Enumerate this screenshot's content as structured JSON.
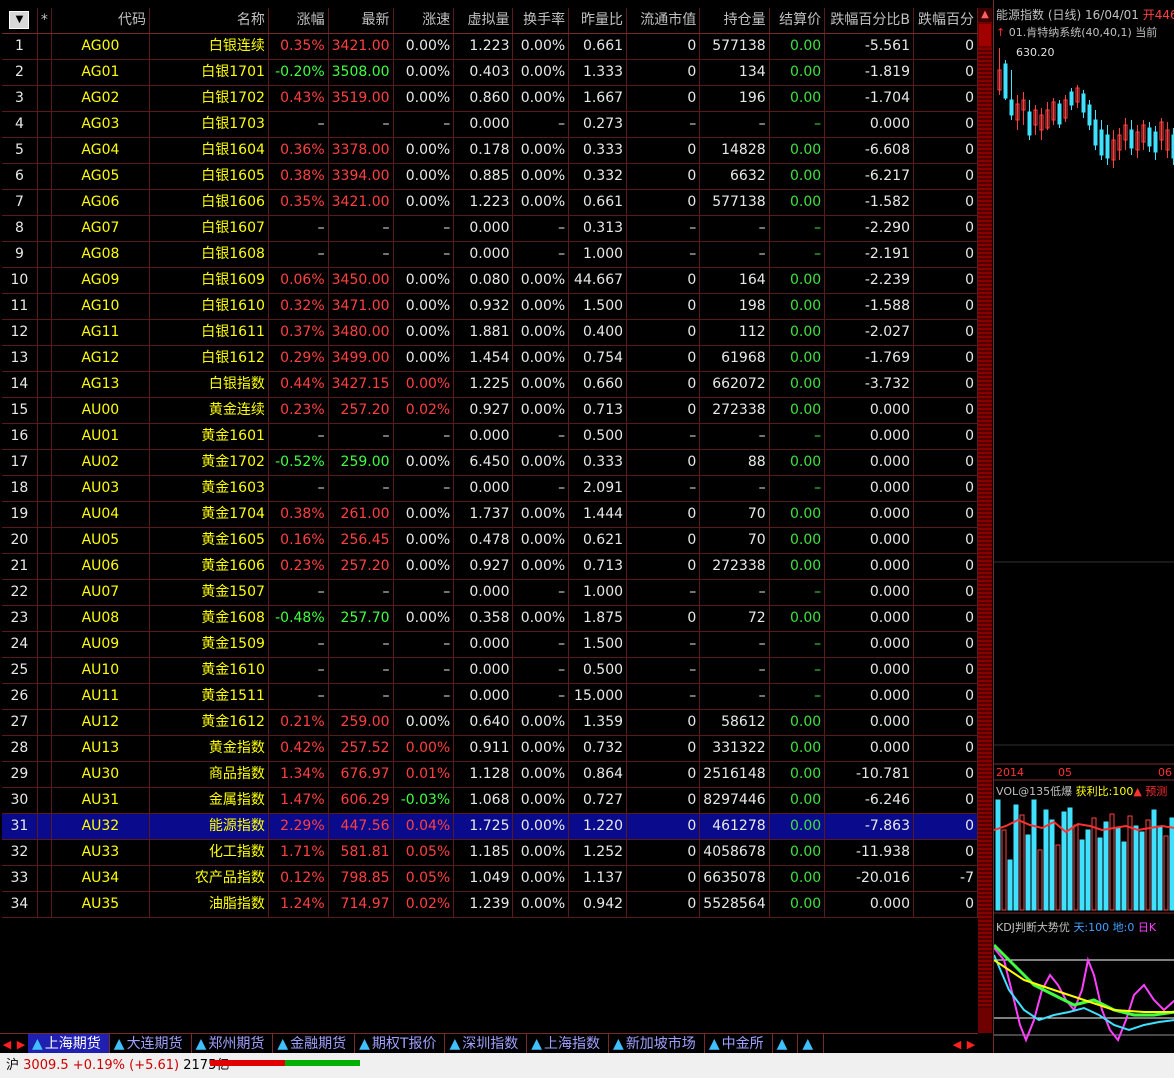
{
  "table": {
    "headers": [
      "*",
      "代码",
      "名称",
      "涨幅",
      "最新",
      "涨速",
      "虚拟量",
      "换手率",
      "昨量比",
      "流通市值",
      "持仓量",
      "结算价",
      "跌幅百分比B",
      "跌幅百分"
    ],
    "sort_icon": "sort-down-icon",
    "selected_row": 31,
    "rows": [
      {
        "idx": "1",
        "code": "AG00",
        "name": "白银连续",
        "chg": "0.35%",
        "last": "3421.00",
        "spd": "0.00%",
        "vol": "1.223",
        "turn": "0.00%",
        "vr": "0.661",
        "mv": "0",
        "oi": "577138",
        "settle": "0.00",
        "pb": "-5.561",
        "pc": "0",
        "dir": "up"
      },
      {
        "idx": "2",
        "code": "AG01",
        "name": "白银1701",
        "chg": "-0.20%",
        "last": "3508.00",
        "spd": "0.00%",
        "vol": "0.403",
        "turn": "0.00%",
        "vr": "1.333",
        "mv": "0",
        "oi": "134",
        "settle": "0.00",
        "pb": "-1.819",
        "pc": "0",
        "dir": "dn"
      },
      {
        "idx": "3",
        "code": "AG02",
        "name": "白银1702",
        "chg": "0.43%",
        "last": "3519.00",
        "spd": "0.00%",
        "vol": "0.860",
        "turn": "0.00%",
        "vr": "1.667",
        "mv": "0",
        "oi": "196",
        "settle": "0.00",
        "pb": "-1.704",
        "pc": "0",
        "dir": "up"
      },
      {
        "idx": "4",
        "code": "AG03",
        "name": "白银1703",
        "chg": "–",
        "last": "–",
        "spd": "–",
        "vol": "0.000",
        "turn": "–",
        "vr": "0.273",
        "mv": "–",
        "oi": "–",
        "settle": "–",
        "pb": "0.000",
        "pc": "0",
        "dir": "none"
      },
      {
        "idx": "5",
        "code": "AG04",
        "name": "白银1604",
        "chg": "0.36%",
        "last": "3378.00",
        "spd": "0.00%",
        "vol": "0.178",
        "turn": "0.00%",
        "vr": "0.333",
        "mv": "0",
        "oi": "14828",
        "settle": "0.00",
        "pb": "-6.608",
        "pc": "0",
        "dir": "up"
      },
      {
        "idx": "6",
        "code": "AG05",
        "name": "白银1605",
        "chg": "0.38%",
        "last": "3394.00",
        "spd": "0.00%",
        "vol": "0.885",
        "turn": "0.00%",
        "vr": "0.332",
        "mv": "0",
        "oi": "6632",
        "settle": "0.00",
        "pb": "-6.217",
        "pc": "0",
        "dir": "up"
      },
      {
        "idx": "7",
        "code": "AG06",
        "name": "白银1606",
        "chg": "0.35%",
        "last": "3421.00",
        "spd": "0.00%",
        "vol": "1.223",
        "turn": "0.00%",
        "vr": "0.661",
        "mv": "0",
        "oi": "577138",
        "settle": "0.00",
        "pb": "-1.582",
        "pc": "0",
        "dir": "up"
      },
      {
        "idx": "8",
        "code": "AG07",
        "name": "白银1607",
        "chg": "–",
        "last": "–",
        "spd": "–",
        "vol": "0.000",
        "turn": "–",
        "vr": "0.313",
        "mv": "–",
        "oi": "–",
        "settle": "–",
        "pb": "-2.290",
        "pc": "0",
        "dir": "none"
      },
      {
        "idx": "9",
        "code": "AG08",
        "name": "白银1608",
        "chg": "–",
        "last": "–",
        "spd": "–",
        "vol": "0.000",
        "turn": "–",
        "vr": "1.000",
        "mv": "–",
        "oi": "–",
        "settle": "–",
        "pb": "-2.191",
        "pc": "0",
        "dir": "none"
      },
      {
        "idx": "10",
        "code": "AG09",
        "name": "白银1609",
        "chg": "0.06%",
        "last": "3450.00",
        "spd": "0.00%",
        "vol": "0.080",
        "turn": "0.00%",
        "vr": "44.667",
        "mv": "0",
        "oi": "164",
        "settle": "0.00",
        "pb": "-2.239",
        "pc": "0",
        "dir": "up"
      },
      {
        "idx": "11",
        "code": "AG10",
        "name": "白银1610",
        "chg": "0.32%",
        "last": "3471.00",
        "spd": "0.00%",
        "vol": "0.932",
        "turn": "0.00%",
        "vr": "1.500",
        "mv": "0",
        "oi": "198",
        "settle": "0.00",
        "pb": "-1.588",
        "pc": "0",
        "dir": "up"
      },
      {
        "idx": "12",
        "code": "AG11",
        "name": "白银1611",
        "chg": "0.37%",
        "last": "3480.00",
        "spd": "0.00%",
        "vol": "1.881",
        "turn": "0.00%",
        "vr": "0.400",
        "mv": "0",
        "oi": "112",
        "settle": "0.00",
        "pb": "-2.027",
        "pc": "0",
        "dir": "up"
      },
      {
        "idx": "13",
        "code": "AG12",
        "name": "白银1612",
        "chg": "0.29%",
        "last": "3499.00",
        "spd": "0.00%",
        "vol": "1.454",
        "turn": "0.00%",
        "vr": "0.754",
        "mv": "0",
        "oi": "61968",
        "settle": "0.00",
        "pb": "-1.769",
        "pc": "0",
        "dir": "up"
      },
      {
        "idx": "14",
        "code": "AG13",
        "name": "白银指数",
        "chg": "0.44%",
        "last": "3427.15",
        "spd": "0.00%",
        "vol": "1.225",
        "turn": "0.00%",
        "vr": "0.660",
        "mv": "0",
        "oi": "662072",
        "settle": "0.00",
        "pb": "-3.732",
        "pc": "0",
        "dir": "up",
        "spdDir": "up"
      },
      {
        "idx": "15",
        "code": "AU00",
        "name": "黄金连续",
        "chg": "0.23%",
        "last": "257.20",
        "spd": "0.02%",
        "vol": "0.927",
        "turn": "0.00%",
        "vr": "0.713",
        "mv": "0",
        "oi": "272338",
        "settle": "0.00",
        "pb": "0.000",
        "pc": "0",
        "dir": "up",
        "spdDir": "up"
      },
      {
        "idx": "16",
        "code": "AU01",
        "name": "黄金1601",
        "chg": "–",
        "last": "–",
        "spd": "–",
        "vol": "0.000",
        "turn": "–",
        "vr": "0.500",
        "mv": "–",
        "oi": "–",
        "settle": "–",
        "pb": "0.000",
        "pc": "0",
        "dir": "none"
      },
      {
        "idx": "17",
        "code": "AU02",
        "name": "黄金1702",
        "chg": "-0.52%",
        "last": "259.00",
        "spd": "0.00%",
        "vol": "6.450",
        "turn": "0.00%",
        "vr": "0.333",
        "mv": "0",
        "oi": "88",
        "settle": "0.00",
        "pb": "0.000",
        "pc": "0",
        "dir": "dn"
      },
      {
        "idx": "18",
        "code": "AU03",
        "name": "黄金1603",
        "chg": "–",
        "last": "–",
        "spd": "–",
        "vol": "0.000",
        "turn": "–",
        "vr": "2.091",
        "mv": "–",
        "oi": "–",
        "settle": "–",
        "pb": "0.000",
        "pc": "0",
        "dir": "none"
      },
      {
        "idx": "19",
        "code": "AU04",
        "name": "黄金1704",
        "chg": "0.38%",
        "last": "261.00",
        "spd": "0.00%",
        "vol": "1.737",
        "turn": "0.00%",
        "vr": "1.444",
        "mv": "0",
        "oi": "70",
        "settle": "0.00",
        "pb": "0.000",
        "pc": "0",
        "dir": "up"
      },
      {
        "idx": "20",
        "code": "AU05",
        "name": "黄金1605",
        "chg": "0.16%",
        "last": "256.45",
        "spd": "0.00%",
        "vol": "0.478",
        "turn": "0.00%",
        "vr": "0.621",
        "mv": "0",
        "oi": "70",
        "settle": "0.00",
        "pb": "0.000",
        "pc": "0",
        "dir": "up"
      },
      {
        "idx": "21",
        "code": "AU06",
        "name": "黄金1606",
        "chg": "0.23%",
        "last": "257.20",
        "spd": "0.00%",
        "vol": "0.927",
        "turn": "0.00%",
        "vr": "0.713",
        "mv": "0",
        "oi": "272338",
        "settle": "0.00",
        "pb": "0.000",
        "pc": "0",
        "dir": "up"
      },
      {
        "idx": "22",
        "code": "AU07",
        "name": "黄金1507",
        "chg": "–",
        "last": "–",
        "spd": "–",
        "vol": "0.000",
        "turn": "–",
        "vr": "1.000",
        "mv": "–",
        "oi": "–",
        "settle": "–",
        "pb": "0.000",
        "pc": "0",
        "dir": "none"
      },
      {
        "idx": "23",
        "code": "AU08",
        "name": "黄金1608",
        "chg": "-0.48%",
        "last": "257.70",
        "spd": "0.00%",
        "vol": "0.358",
        "turn": "0.00%",
        "vr": "1.875",
        "mv": "0",
        "oi": "72",
        "settle": "0.00",
        "pb": "0.000",
        "pc": "0",
        "dir": "dn"
      },
      {
        "idx": "24",
        "code": "AU09",
        "name": "黄金1509",
        "chg": "–",
        "last": "–",
        "spd": "–",
        "vol": "0.000",
        "turn": "–",
        "vr": "1.500",
        "mv": "–",
        "oi": "–",
        "settle": "–",
        "pb": "0.000",
        "pc": "0",
        "dir": "none"
      },
      {
        "idx": "25",
        "code": "AU10",
        "name": "黄金1610",
        "chg": "–",
        "last": "–",
        "spd": "–",
        "vol": "0.000",
        "turn": "–",
        "vr": "0.500",
        "mv": "–",
        "oi": "–",
        "settle": "–",
        "pb": "0.000",
        "pc": "0",
        "dir": "none"
      },
      {
        "idx": "26",
        "code": "AU11",
        "name": "黄金1511",
        "chg": "–",
        "last": "–",
        "spd": "–",
        "vol": "0.000",
        "turn": "–",
        "vr": "15.000",
        "mv": "–",
        "oi": "–",
        "settle": "–",
        "pb": "0.000",
        "pc": "0",
        "dir": "none"
      },
      {
        "idx": "27",
        "code": "AU12",
        "name": "黄金1612",
        "chg": "0.21%",
        "last": "259.00",
        "spd": "0.00%",
        "vol": "0.640",
        "turn": "0.00%",
        "vr": "1.359",
        "mv": "0",
        "oi": "58612",
        "settle": "0.00",
        "pb": "0.000",
        "pc": "0",
        "dir": "up"
      },
      {
        "idx": "28",
        "code": "AU13",
        "name": "黄金指数",
        "chg": "0.42%",
        "last": "257.52",
        "spd": "0.00%",
        "vol": "0.911",
        "turn": "0.00%",
        "vr": "0.732",
        "mv": "0",
        "oi": "331322",
        "settle": "0.00",
        "pb": "0.000",
        "pc": "0",
        "dir": "up",
        "spdDir": "up"
      },
      {
        "idx": "29",
        "code": "AU30",
        "name": "商品指数",
        "chg": "1.34%",
        "last": "676.97",
        "spd": "0.01%",
        "vol": "1.128",
        "turn": "0.00%",
        "vr": "0.864",
        "mv": "0",
        "oi": "2516148",
        "settle": "0.00",
        "pb": "-10.781",
        "pc": "0",
        "dir": "up",
        "spdDir": "up"
      },
      {
        "idx": "30",
        "code": "AU31",
        "name": "金属指数",
        "chg": "1.47%",
        "last": "606.29",
        "spd": "-0.03%",
        "vol": "1.068",
        "turn": "0.00%",
        "vr": "0.727",
        "mv": "0",
        "oi": "8297446",
        "settle": "0.00",
        "pb": "-6.246",
        "pc": "0",
        "dir": "up",
        "spdDir": "dn"
      },
      {
        "idx": "31",
        "code": "AU32",
        "name": "能源指数",
        "chg": "2.29%",
        "last": "447.56",
        "spd": "0.04%",
        "vol": "1.725",
        "turn": "0.00%",
        "vr": "1.220",
        "mv": "0",
        "oi": "461278",
        "settle": "0.00",
        "pb": "-7.863",
        "pc": "0",
        "dir": "up",
        "spdDir": "up"
      },
      {
        "idx": "32",
        "code": "AU33",
        "name": "化工指数",
        "chg": "1.71%",
        "last": "581.81",
        "spd": "0.05%",
        "vol": "1.185",
        "turn": "0.00%",
        "vr": "1.252",
        "mv": "0",
        "oi": "4058678",
        "settle": "0.00",
        "pb": "-11.938",
        "pc": "0",
        "dir": "up",
        "spdDir": "up"
      },
      {
        "idx": "33",
        "code": "AU34",
        "name": "农产品指数",
        "chg": "0.12%",
        "last": "798.85",
        "spd": "0.05%",
        "vol": "1.049",
        "turn": "0.00%",
        "vr": "1.137",
        "mv": "0",
        "oi": "6635078",
        "settle": "0.00",
        "pb": "-20.016",
        "pc": "-7",
        "dir": "up",
        "spdDir": "up"
      },
      {
        "idx": "34",
        "code": "AU35",
        "name": "油脂指数",
        "chg": "1.24%",
        "last": "714.97",
        "spd": "0.02%",
        "vol": "1.239",
        "turn": "0.00%",
        "vr": "0.942",
        "mv": "0",
        "oi": "5528564",
        "settle": "0.00",
        "pb": "0.000",
        "pc": "0",
        "dir": "up",
        "spdDir": "up"
      }
    ]
  },
  "tabs": [
    {
      "label": "上海期货",
      "active": true
    },
    {
      "label": "大连期货"
    },
    {
      "label": "郑州期货"
    },
    {
      "label": "金融期货"
    },
    {
      "label": "期权T报价"
    },
    {
      "label": "深圳指数"
    },
    {
      "label": "上海指数"
    },
    {
      "label": "新加坡市场"
    },
    {
      "label": "中金所"
    },
    {
      "label": ""
    },
    {
      "label": ""
    }
  ],
  "status": {
    "market": "沪",
    "index": "3009.5",
    "change": "+0.19% (+5.61)",
    "amount": "2175亿"
  },
  "chart": {
    "title": "能源指数 (日线)",
    "date": "16/04/01",
    "open_label": "开446",
    "system": "01.肯特纳系统(40,40,1)",
    "system_extra": "当前",
    "high": "630.20",
    "date_left": "2014",
    "date_mid": "05",
    "date_right": "06",
    "vol_title": "VOL@135低爆",
    "vol_profit": "获利比:100",
    "vol_extra": "预测",
    "kdj_title": "KDJ判断大势优",
    "kdj_sky": "天:100",
    "kdj_ground": "地:0",
    "kdj_extra": "日K"
  },
  "colors": {
    "up": "#ff4040",
    "down": "#40ff40",
    "code": "#ffff00",
    "selected": "#0a0a8c",
    "border": "#5a1a1a"
  }
}
